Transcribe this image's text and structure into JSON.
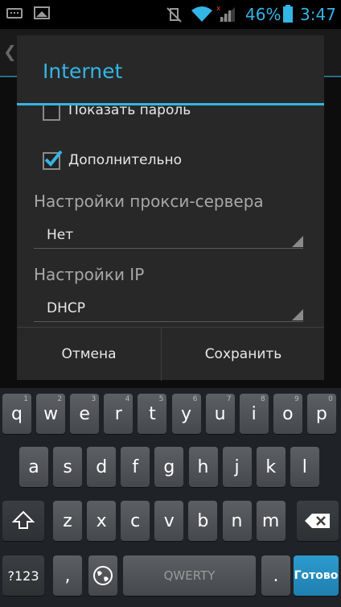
{
  "status_bar": {
    "battery": "46%",
    "time": "3:47"
  },
  "dialog": {
    "title": "Internet",
    "show_password": {
      "label": "Показать пароль",
      "checked": false
    },
    "advanced": {
      "label": "Дополнительно",
      "checked": true
    },
    "proxy": {
      "label": "Настройки прокси-сервера",
      "value": "Нет"
    },
    "ip": {
      "label": "Настройки IP",
      "value": "DHCP"
    },
    "cancel_label": "Отмена",
    "save_label": "Сохранить"
  },
  "keyboard": {
    "row1": [
      {
        "k": "q",
        "h": "1"
      },
      {
        "k": "w",
        "h": "2"
      },
      {
        "k": "e",
        "h": "3"
      },
      {
        "k": "r",
        "h": "4"
      },
      {
        "k": "t",
        "h": "5"
      },
      {
        "k": "y",
        "h": "6"
      },
      {
        "k": "u",
        "h": "7"
      },
      {
        "k": "i",
        "h": "8"
      },
      {
        "k": "o",
        "h": "9"
      },
      {
        "k": "p",
        "h": "0"
      }
    ],
    "row2": [
      "a",
      "s",
      "d",
      "f",
      "g",
      "h",
      "j",
      "k",
      "l"
    ],
    "row3": [
      "z",
      "x",
      "c",
      "v",
      "b",
      "n",
      "m"
    ],
    "symbols_label": "?123",
    "comma": ",",
    "space_label": "QWERTY",
    "period": ".",
    "enter_label": "Готово",
    "colors": {
      "accent": "#33b5e5",
      "key": "#55585c",
      "enter": "#2a93c8"
    }
  }
}
